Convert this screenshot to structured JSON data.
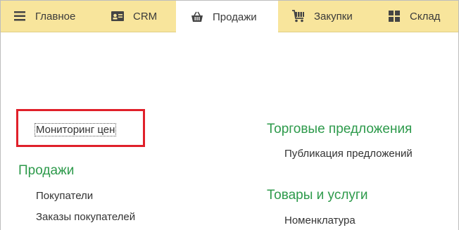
{
  "tabs": [
    {
      "label": "Главное",
      "icon": "hamburger-menu-icon"
    },
    {
      "label": "CRM",
      "icon": "contact-card-icon"
    },
    {
      "label": "Продажи",
      "icon": "shopping-basket-icon",
      "active": true
    },
    {
      "label": "Закупки",
      "icon": "shopping-cart-icon"
    },
    {
      "label": "Склад",
      "icon": "grid-blocks-icon"
    }
  ],
  "left": {
    "top_link": "Мониторинг цен",
    "section_title": "Продажи",
    "links": [
      "Покупатели",
      "Заказы покупателей"
    ]
  },
  "right": {
    "section1_title": "Торговые предложения",
    "section1_links": [
      "Публикация предложений"
    ],
    "section2_title": "Товары и услуги",
    "section2_links": [
      "Номенклатура"
    ]
  },
  "colors": {
    "menu_bar": "#f8e59c",
    "section_title": "#2d9a4b",
    "highlight_frame": "#e0202a"
  }
}
